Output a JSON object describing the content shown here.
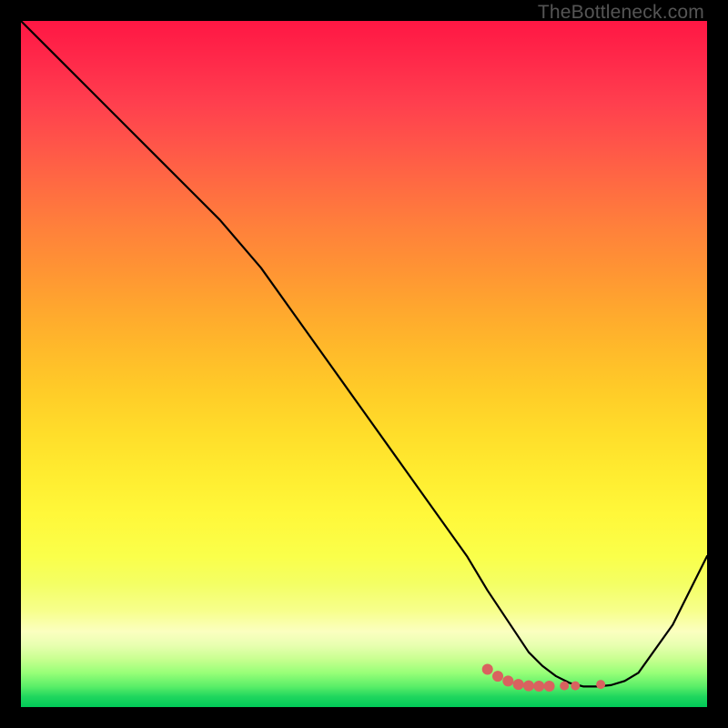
{
  "attribution": "TheBottleneck.com",
  "chart_data": {
    "type": "line",
    "title": "",
    "xlabel": "",
    "ylabel": "",
    "xlim": [
      0,
      100
    ],
    "ylim": [
      0,
      100
    ],
    "series": [
      {
        "name": "bottleneck-curve",
        "x": [
          0,
          5,
          10,
          15,
          20,
          25,
          29,
          35,
          40,
          45,
          50,
          55,
          60,
          65,
          68,
          70,
          72,
          74,
          76,
          78,
          80,
          82,
          84,
          86,
          88,
          90,
          95,
          100
        ],
        "y": [
          100,
          95,
          90,
          85,
          80,
          75,
          71,
          64,
          57,
          50,
          43,
          36,
          29,
          22,
          17,
          14,
          11,
          8,
          6,
          4.5,
          3.5,
          3,
          3,
          3.2,
          3.8,
          5,
          12,
          22
        ]
      }
    ],
    "markers": {
      "name": "optimal-zone",
      "color": "#d9625f",
      "points": [
        {
          "x": 68,
          "y": 5.5,
          "r": 6
        },
        {
          "x": 69.5,
          "y": 4.5,
          "r": 6
        },
        {
          "x": 71,
          "y": 3.8,
          "r": 6
        },
        {
          "x": 72.5,
          "y": 3.3,
          "r": 6
        },
        {
          "x": 74,
          "y": 3.1,
          "r": 6
        },
        {
          "x": 75.5,
          "y": 3.05,
          "r": 6
        },
        {
          "x": 77,
          "y": 3.05,
          "r": 6
        },
        {
          "x": 79.2,
          "y": 3.1,
          "r": 5
        },
        {
          "x": 80.8,
          "y": 3.1,
          "r": 5
        },
        {
          "x": 84.5,
          "y": 3.3,
          "r": 5
        }
      ]
    }
  }
}
